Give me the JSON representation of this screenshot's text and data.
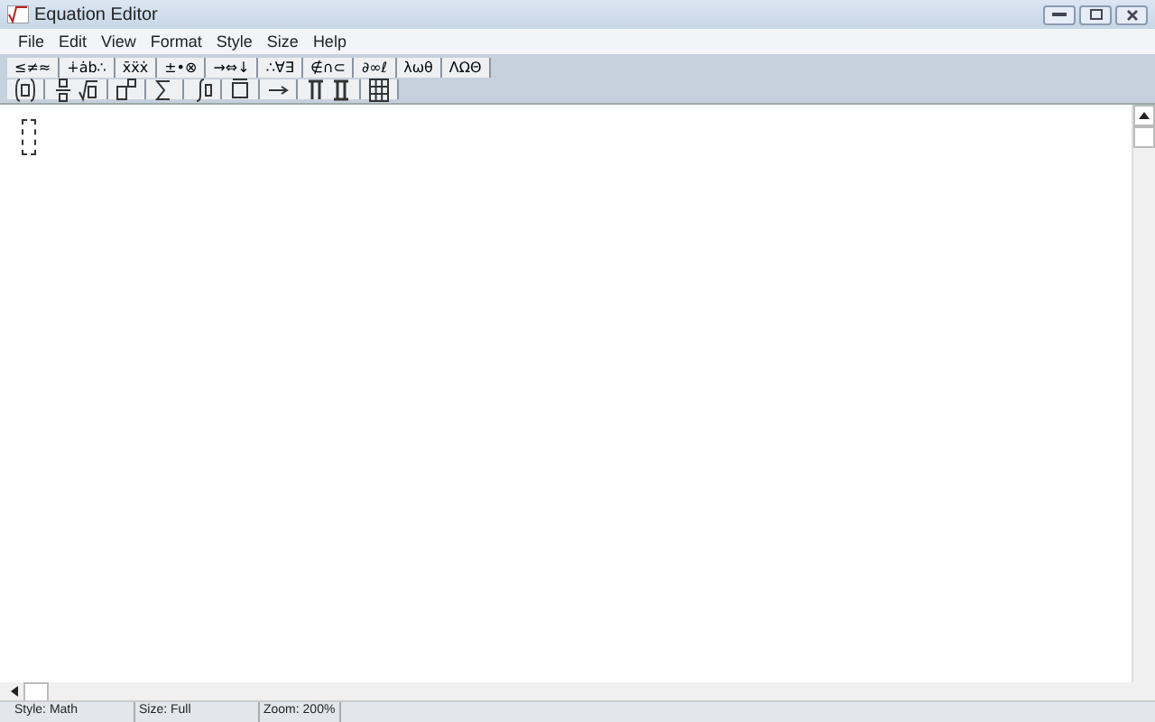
{
  "window": {
    "title": "Equation Editor"
  },
  "menu": [
    "File",
    "Edit",
    "View",
    "Format",
    "Style",
    "Size",
    "Help"
  ],
  "symbol_palettes": [
    "≤≠≈",
    "∔ȧb∴",
    "x̄ẍẋ",
    "±•⊗",
    "→⇔↓",
    "∴∀∃",
    "∉∩⊂",
    "∂∞ℓ",
    "λωθ",
    "ΛΩΘ"
  ],
  "status_bar": [
    "Style: Math",
    "Size: Full",
    "Zoom: 200%"
  ]
}
